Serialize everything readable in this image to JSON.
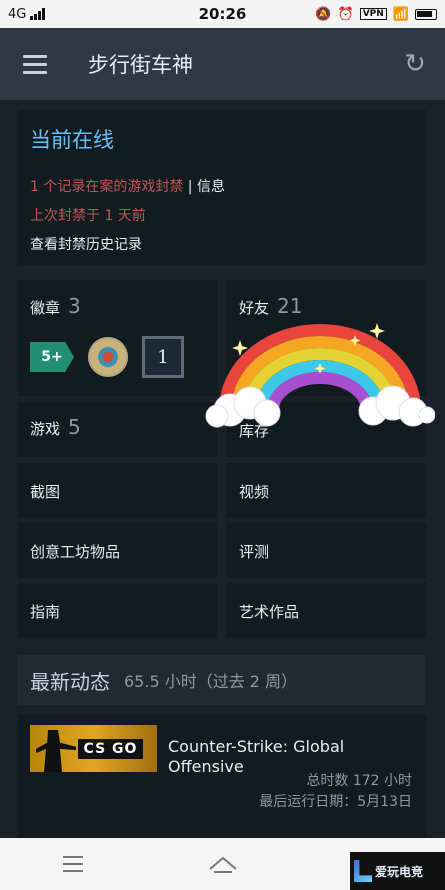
{
  "status": {
    "network": "4G",
    "time": "20:26",
    "vpn": "VPN"
  },
  "appbar": {
    "title": "步行街车神"
  },
  "online": {
    "heading": "当前在线",
    "ban_record": "1 个记录在案的游戏封禁",
    "separator": " | ",
    "info_link": "信息",
    "last_ban": "上次封禁于 1 天前",
    "history_link": "查看封禁历史记录"
  },
  "badges": {
    "label": "徽章",
    "count": "3",
    "badge_5": "5+",
    "badge_level": "1"
  },
  "friends": {
    "label": "好友",
    "count": "21"
  },
  "games": {
    "label": "游戏",
    "count": "5"
  },
  "inventory": {
    "label": "库存"
  },
  "menu": {
    "screenshots": "截图",
    "videos": "视频",
    "workshop": "创意工坊物品",
    "reviews": "评测",
    "guides": "指南",
    "artwork": "艺术作品"
  },
  "recent": {
    "heading": "最新动态",
    "summary": "65.5 小时（过去 2 周）"
  },
  "game": {
    "name": "Counter-Strike: Global Offensive",
    "logo_text": "CS GO",
    "total": "总时数 172 小时",
    "last_played": "最后运行日期：5月13日"
  },
  "watermark": {
    "text": "爱玩电竞"
  },
  "colors": {
    "accent": "#66c0f4",
    "ban_red": "#c15755",
    "panel": "#121b20",
    "appbar": "#2f3946"
  }
}
